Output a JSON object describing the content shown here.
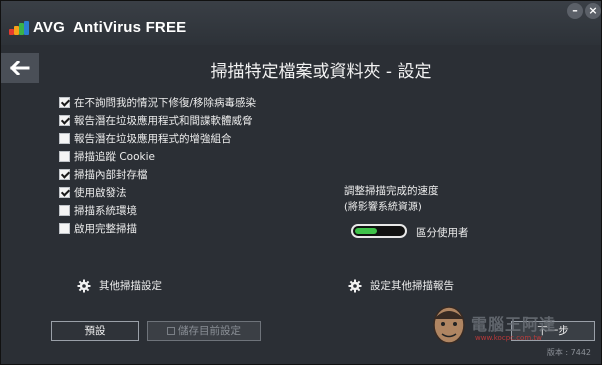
{
  "app": {
    "name": "AntiVirus FREE",
    "brand": "AVG",
    "title": "掃描特定檔案或資料夾 - 設定"
  },
  "window_controls": {
    "minimize": "–",
    "close": "×"
  },
  "options": [
    {
      "label": "在不詢問我的情況下修復/移除病毒感染",
      "checked": true
    },
    {
      "label": "報告潛在垃圾應用程式和間諜軟體威脅",
      "checked": true
    },
    {
      "label": "報告潛在垃圾應用程式的增強組合",
      "checked": false
    },
    {
      "label": "掃描追蹤 Cookie",
      "checked": false
    },
    {
      "label": "掃描內部封存檔",
      "checked": true
    },
    {
      "label": "使用啟發法",
      "checked": true
    },
    {
      "label": "掃描系統環境",
      "checked": false
    },
    {
      "label": "啟用完整掃描",
      "checked": false
    }
  ],
  "speed": {
    "title": "調整掃描完成的速度",
    "subtitle": "(將影響系統資源)",
    "level_fraction": 0.45,
    "label": "區分使用者"
  },
  "links": {
    "other_scan_settings": "其他掃描設定",
    "other_scan_reports": "設定其他掃描報告"
  },
  "buttons": {
    "default": "預設",
    "save_current": "儲存目前設定",
    "next": "下一步"
  },
  "version": "版本 : 7442",
  "watermark": {
    "text": "電腦王阿達",
    "url": "www.kocpc.com.tw"
  },
  "colors": {
    "background": "#2b2f35",
    "accent_green": "#3fc24a",
    "logo_colors": [
      "#e53a2f",
      "#f6a21a",
      "#3bb24a",
      "#2a7ed3"
    ]
  }
}
